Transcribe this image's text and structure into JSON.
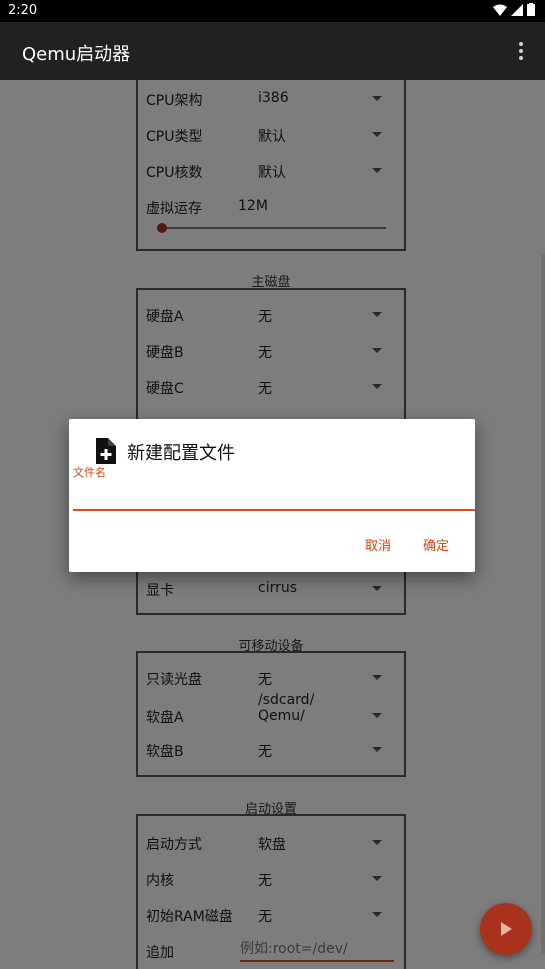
{
  "status": {
    "time": "2:20"
  },
  "appbar": {
    "title": "Qemu启动器"
  },
  "cpu_group": {
    "rows": [
      {
        "label": "CPU架构",
        "value": "i386"
      },
      {
        "label": "CPU类型",
        "value": "默认"
      },
      {
        "label": "CPU核数",
        "value": "默认"
      }
    ],
    "memory_label": "虚拟运存",
    "memory_value": "12M",
    "memory_level": 0.0
  },
  "disk_section": {
    "title": "主磁盘",
    "rows": [
      {
        "label": "硬盘A",
        "value": "无"
      },
      {
        "label": "硬盘B",
        "value": "无"
      },
      {
        "label": "硬盘C",
        "value": "无"
      }
    ]
  },
  "display_row": {
    "label": "显卡",
    "value": "cirrus"
  },
  "removable_section": {
    "title": "可移动设备",
    "rows": [
      {
        "label": "只读光盘",
        "value": "无"
      },
      {
        "label": "软盘A",
        "value": "/sdcard/\nQemu/"
      },
      {
        "label": "软盘B",
        "value": "无"
      }
    ]
  },
  "boot_section": {
    "title": "启动设置",
    "rows": [
      {
        "label": "启动方式",
        "value": "软盘"
      },
      {
        "label": "内核",
        "value": "无"
      },
      {
        "label": "初始RAM磁盘",
        "value": "无"
      }
    ],
    "append_label": "追加",
    "append_placeholder": "例如:root=/dev/"
  },
  "dialog": {
    "title": "新建配置文件",
    "field_label": "文件名",
    "field_value": "",
    "cancel": "取消",
    "ok": "确定"
  },
  "colors": {
    "accent": "#e64a19",
    "appbar": "#212121",
    "fab": "#a8321c"
  }
}
